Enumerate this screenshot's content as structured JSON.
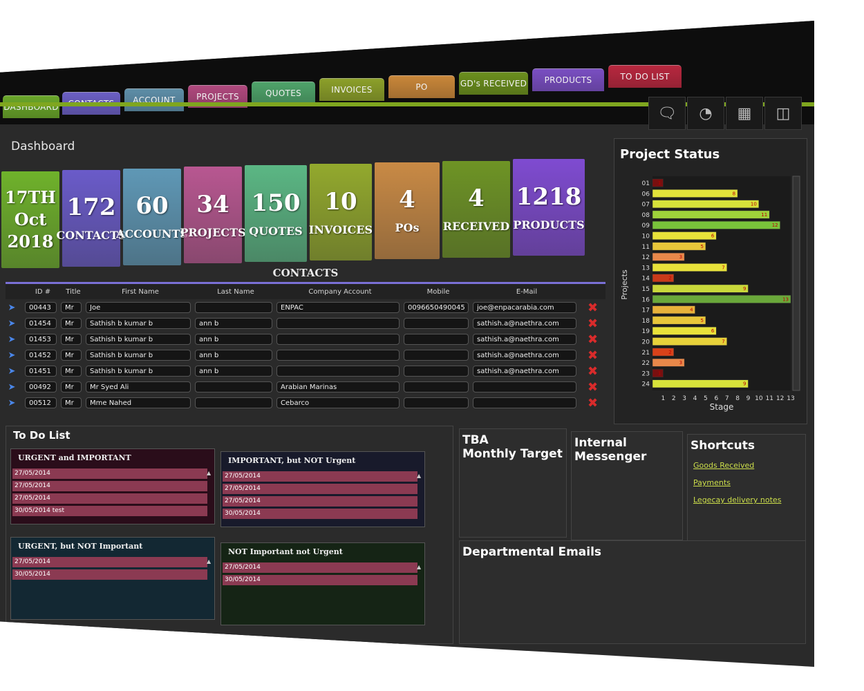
{
  "tabs": [
    {
      "label": "Dashboard",
      "color": "#6aa72a"
    },
    {
      "label": "Contacts",
      "color": "#6b5fc4"
    },
    {
      "label": "Account",
      "color": "#5e8ea8"
    },
    {
      "label": "Projects",
      "color": "#b0497e"
    },
    {
      "label": "Quotes",
      "color": "#4fa36a"
    },
    {
      "label": "Invoices",
      "color": "#8ca02a"
    },
    {
      "label": "PO",
      "color": "#c9873a"
    },
    {
      "label": "GD's RECEIVED",
      "color": "#6b8f1e"
    },
    {
      "label": "PRODUCTS",
      "color": "#7a4fc2"
    },
    {
      "label": "TO DO LIST",
      "color": "#b8283f"
    }
  ],
  "toolbar": {
    "icons": [
      "chat-icon",
      "gauge-icon",
      "calendar-icon",
      "report-icon"
    ]
  },
  "page_title": "Dashboard",
  "tiles": [
    {
      "num1": "17TH",
      "num2": "Oct",
      "num3": "2018",
      "color": "#6fb22b"
    },
    {
      "num": "172",
      "label": "CONTACTS",
      "color": "#6a5bc9"
    },
    {
      "num": "60",
      "label": "ACCOUNTS",
      "color": "#5f98b6"
    },
    {
      "num": "34",
      "label": "PROJECTS",
      "color": "#b85791"
    },
    {
      "num": "150",
      "label": "QUOTES",
      "color": "#5bb784"
    },
    {
      "num": "10",
      "label": "INVOICES",
      "color": "#93a92d"
    },
    {
      "num": "4",
      "label": "POs",
      "color": "#c98a45"
    },
    {
      "num": "4",
      "label": "RECEIVED",
      "color": "#6e9425"
    },
    {
      "num": "1218",
      "label": "PRODUCTS",
      "color": "#7f4bd1"
    }
  ],
  "contacts": {
    "title": "CONTACTS",
    "headers": [
      "ID #",
      "Title",
      "First Name",
      "Last Name",
      "Company Account",
      "Mobile",
      "E-Mail"
    ],
    "rows": [
      {
        "id": "00443",
        "title": "Mr",
        "first": "Joe",
        "last": "",
        "company": "ENPAC",
        "mobile": "0096650490045",
        "email": "joe@enpacarabia.com"
      },
      {
        "id": "01454",
        "title": "Mr",
        "first": "Sathish  b kumar  b",
        "last": "ann  b",
        "company": "",
        "mobile": "",
        "email": "sathish.a@naethra.com"
      },
      {
        "id": "01453",
        "title": "Mr",
        "first": "Sathish  b kumar  b",
        "last": "ann  b",
        "company": "",
        "mobile": "",
        "email": "sathish.a@naethra.com"
      },
      {
        "id": "01452",
        "title": "Mr",
        "first": "Sathish  b kumar  b",
        "last": "ann  b",
        "company": "",
        "mobile": "",
        "email": "sathish.a@naethra.com"
      },
      {
        "id": "01451",
        "title": "Mr",
        "first": "Sathish  b kumar  b",
        "last": "ann  b",
        "company": "",
        "mobile": "",
        "email": "sathish.a@naethra.com"
      },
      {
        "id": "00492",
        "title": "Mr",
        "first": "Mr Syed Ali",
        "last": "",
        "company": "Arabian Marinas",
        "mobile": "",
        "email": ""
      },
      {
        "id": "00512",
        "title": "Mr",
        "first": "Mme Nahed",
        "last": "",
        "company": "Cebarco",
        "mobile": "",
        "email": ""
      }
    ]
  },
  "project_status": {
    "title": "Project Status"
  },
  "chart_data": {
    "type": "bar",
    "orientation": "horizontal",
    "title": "Project Status",
    "xlabel": "Stage",
    "ylabel": "Projects",
    "categories": [
      "01",
      "06",
      "07",
      "08",
      "09",
      "10",
      "11",
      "12",
      "13",
      "14",
      "15",
      "16",
      "17",
      "18",
      "19",
      "20",
      "21",
      "22",
      "23",
      "24"
    ],
    "values": [
      1,
      8,
      10,
      11,
      12,
      6,
      5,
      3,
      7,
      2,
      9,
      13,
      4,
      5,
      6,
      7,
      2,
      3,
      1,
      9
    ],
    "xlim": [
      0,
      13
    ],
    "xticks": [
      "1",
      "2",
      "3",
      "4",
      "5",
      "6",
      "7",
      "8",
      "9",
      "10",
      "11",
      "12",
      "13"
    ]
  },
  "todo": {
    "title": "To Do List",
    "quadrants": [
      {
        "title": "URGENT and IMPORTANT",
        "bg": "#2a0d1a",
        "items": [
          "27/05/2014",
          "27/05/2014",
          "27/05/2014",
          "30/05/2014  test"
        ]
      },
      {
        "title": "IMPORTANT, but NOT Urgent",
        "bg": "#181a2b",
        "items": [
          "27/05/2014",
          "27/05/2014",
          "27/05/2014",
          "30/05/2014"
        ]
      },
      {
        "title": "URGENT, but NOT Important",
        "bg": "#132833",
        "items": [
          "27/05/2014",
          "30/05/2014"
        ]
      },
      {
        "title": "NOT Important not Urgent",
        "bg": "#152415",
        "items": [
          "27/05/2014",
          "30/05/2014"
        ]
      }
    ]
  },
  "panels": {
    "tba_line1": "TBA",
    "tba_line2": "Monthly Target",
    "messenger_line1": "Internal",
    "messenger_line2": "Messenger",
    "shortcuts_title": "Shortcuts",
    "shortcuts": [
      "Goods Received",
      "Payments",
      "Legecay delivery notes"
    ],
    "emails_title": "Departmental Emails"
  }
}
